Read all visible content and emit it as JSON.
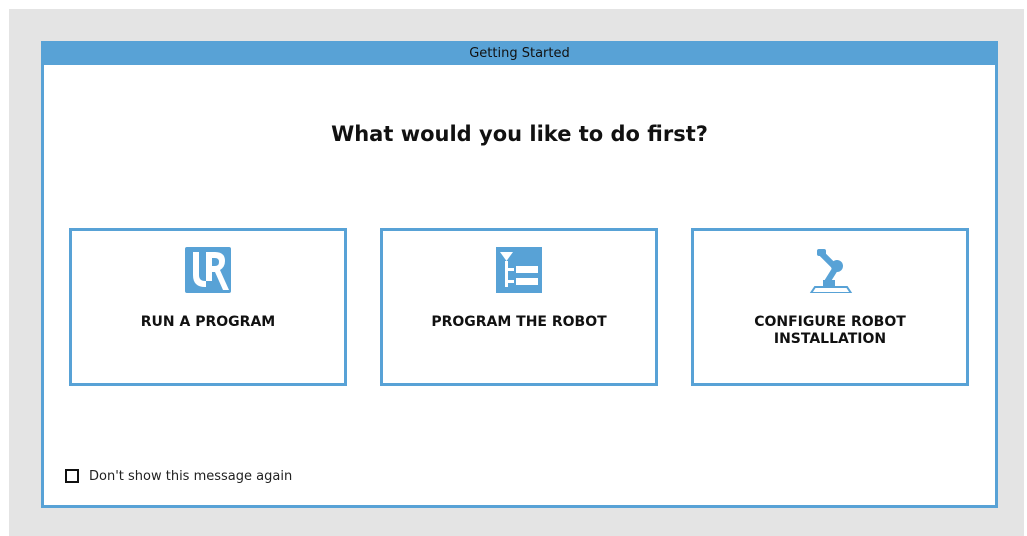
{
  "dialog": {
    "title": "Getting Started",
    "question": "What would you like to do first?",
    "options": [
      {
        "label": "RUN A PROGRAM",
        "icon": "ur-logo-icon"
      },
      {
        "label": "PROGRAM THE ROBOT",
        "icon": "program-tree-icon"
      },
      {
        "label": "CONFIGURE ROBOT\nINSTALLATION",
        "icon": "robot-arm-icon"
      }
    ],
    "dont_show_again": {
      "label": "Don't show this message again",
      "checked": false
    }
  },
  "colors": {
    "accent": "#58a2d6",
    "backdrop": "#e4e4e4"
  }
}
